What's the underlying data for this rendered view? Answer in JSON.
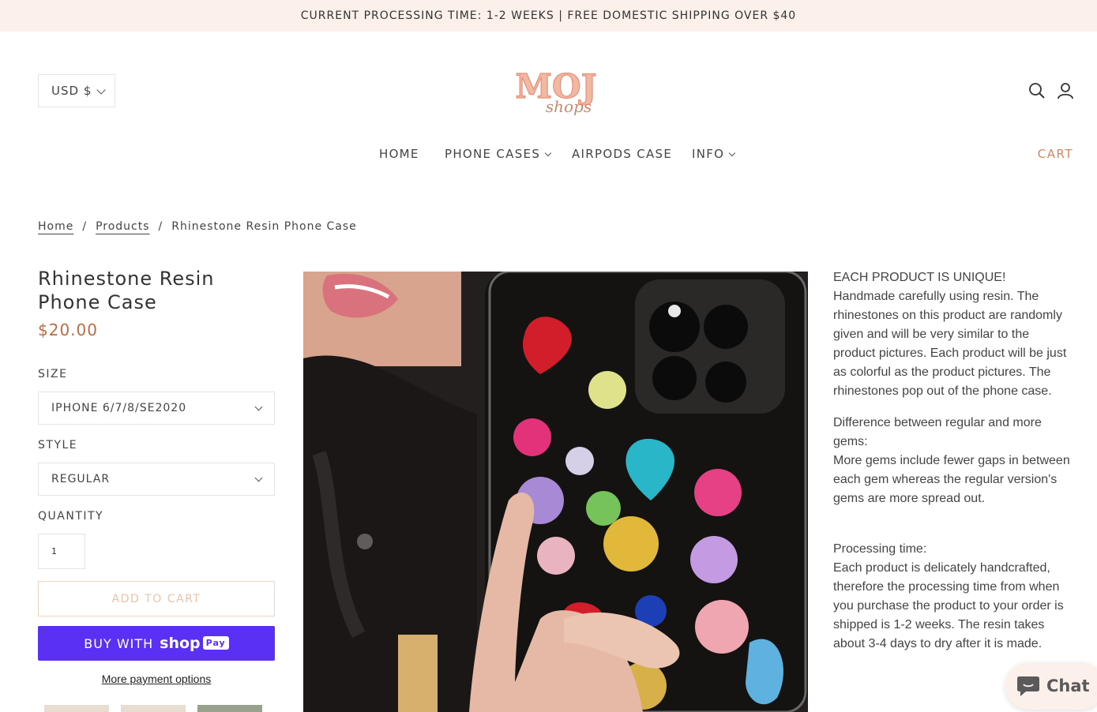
{
  "announcement": "CURRENT PROCESSING TIME: 1-2 WEEKS | FREE DOMESTIC SHIPPING OVER $40",
  "header": {
    "currency": "USD $",
    "logo_text": "MOJ",
    "logo_sub": "shops",
    "search_icon": "search-icon",
    "account_icon": "account-icon"
  },
  "nav": {
    "items": [
      {
        "label": "HOME"
      },
      {
        "label": "PHONE CASES"
      },
      {
        "label": "AIRPODS CASE"
      },
      {
        "label": "INFO"
      }
    ],
    "cart": "CART"
  },
  "breadcrumb": {
    "home": "Home",
    "products": "Products",
    "current": "Rhinestone Resin Phone Case",
    "separator": "/"
  },
  "product": {
    "title": "Rhinestone Resin Phone Case",
    "price": "$20.00",
    "size_label": "SIZE",
    "size_value": "IPHONE 6/7/8/SE2020",
    "style_label": "STYLE",
    "style_value": "REGULAR",
    "quantity_label": "QUANTITY",
    "quantity_value": "1",
    "add_to_cart": "ADD TO CART",
    "buy_with": "BUY WITH",
    "shop": "shop",
    "pay": "Pay",
    "more_payment": "More payment options"
  },
  "description": {
    "p1_line1": "EACH PRODUCT IS UNIQUE!",
    "p1_body": "Handmade carefully using resin. The rhinestones on this product are randomly given and will be very similar to the product pictures. Each product will be just as colorful as the product pictures. The rhinestones pop out of the phone case.",
    "p2_title": "Difference between regular and more gems:",
    "p2_body": "More gems include fewer gaps in between each gem whereas the regular version's gems are more spread out.",
    "p3_title": "Processing time:",
    "p3_body": "Each product is delicately handcrafted, therefore the processing time from when you purchase the product to your order is shipped is 1-2 weeks. The resin takes about 3-4 days to dry after it is made."
  },
  "chat": {
    "label": "Chat"
  },
  "colors": {
    "accent": "#d2875c",
    "price": "#b86d47",
    "shop_pay": "#5a31f4",
    "announcement_bg": "#fbf1ea"
  }
}
